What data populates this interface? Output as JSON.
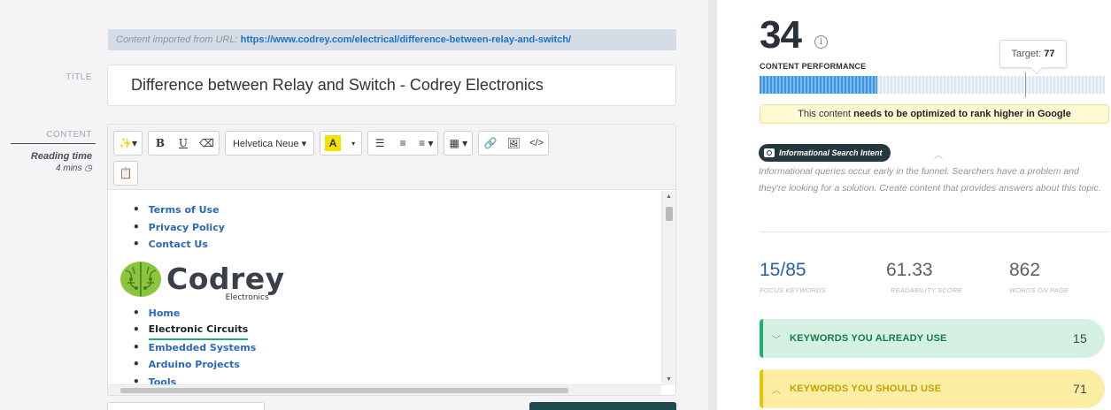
{
  "editor": {
    "import_prefix": "Content imported from URL:",
    "import_url": "https://www.codrey.com/electrical/difference-between-relay-and-switch/",
    "title_label": "TITLE",
    "title_value": "Difference between Relay and Switch - Codrey Electronics",
    "content_label": "CONTENT",
    "reading_time_label": "Reading time",
    "reading_time_value": "4 mins",
    "toolbar": {
      "magic": "✨▾",
      "bold": "B",
      "underline": "U",
      "eraser": "⌫",
      "font": "Helvetica Neue ▾",
      "highlight": "A",
      "highlight_caret": "▾",
      "bullet_list": "☰",
      "numbered_list": "≡",
      "align": "≡ ▾",
      "table": "▦ ▾",
      "link": "🔗",
      "image": "🖼",
      "code": "</>",
      "clipboard": "📋"
    },
    "doc": {
      "top_links": [
        "Terms of Use",
        "Privacy Policy",
        "Contact Us"
      ],
      "logo_word": "Codrey",
      "logo_sub": "Electronics",
      "nav_links": [
        "Home",
        "Electronic Circuits",
        "Embedded Systems",
        "Arduino Projects",
        "Tools"
      ]
    }
  },
  "panel": {
    "score": "34",
    "score_label": "CONTENT PERFORMANCE",
    "target_prefix": "Target:",
    "target_value": "77",
    "score_fraction": 0.34,
    "target_fraction": 0.77,
    "warning_pre": "This content",
    "warning_bold": "needs to be optimized to rank higher in Google",
    "intent_badge": "Informational Search Intent",
    "intent_text": "Informational queries occur early in the funnel. Searchers have a problem and they're looking for a solution. Create content that provides answers about this topic.",
    "stats": {
      "focus_current": "15",
      "focus_total": "/85",
      "focus_label": "FOCUS KEYWORDS",
      "readability_value": "61.33",
      "readability_label": "READABILITY SCORE",
      "words_value": "862",
      "words_label": "WORDS ON PAGE"
    },
    "keywords_use_label": "KEYWORDS YOU ALREADY USE",
    "keywords_use_count": "15",
    "keywords_should_label": "KEYWORDS YOU SHOULD USE",
    "keywords_should_count": "71"
  }
}
